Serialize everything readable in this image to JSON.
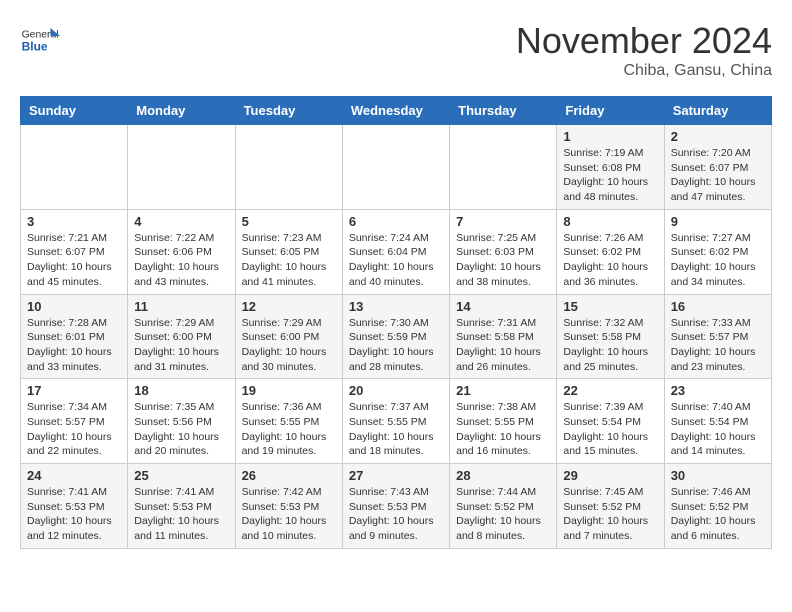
{
  "header": {
    "logo_general": "General",
    "logo_blue": "Blue",
    "month_title": "November 2024",
    "location": "Chiba, Gansu, China"
  },
  "weekdays": [
    "Sunday",
    "Monday",
    "Tuesday",
    "Wednesday",
    "Thursday",
    "Friday",
    "Saturday"
  ],
  "weeks": [
    [
      {
        "day": "",
        "info": ""
      },
      {
        "day": "",
        "info": ""
      },
      {
        "day": "",
        "info": ""
      },
      {
        "day": "",
        "info": ""
      },
      {
        "day": "",
        "info": ""
      },
      {
        "day": "1",
        "info": "Sunrise: 7:19 AM\nSunset: 6:08 PM\nDaylight: 10 hours and 48 minutes."
      },
      {
        "day": "2",
        "info": "Sunrise: 7:20 AM\nSunset: 6:07 PM\nDaylight: 10 hours and 47 minutes."
      }
    ],
    [
      {
        "day": "3",
        "info": "Sunrise: 7:21 AM\nSunset: 6:07 PM\nDaylight: 10 hours and 45 minutes."
      },
      {
        "day": "4",
        "info": "Sunrise: 7:22 AM\nSunset: 6:06 PM\nDaylight: 10 hours and 43 minutes."
      },
      {
        "day": "5",
        "info": "Sunrise: 7:23 AM\nSunset: 6:05 PM\nDaylight: 10 hours and 41 minutes."
      },
      {
        "day": "6",
        "info": "Sunrise: 7:24 AM\nSunset: 6:04 PM\nDaylight: 10 hours and 40 minutes."
      },
      {
        "day": "7",
        "info": "Sunrise: 7:25 AM\nSunset: 6:03 PM\nDaylight: 10 hours and 38 minutes."
      },
      {
        "day": "8",
        "info": "Sunrise: 7:26 AM\nSunset: 6:02 PM\nDaylight: 10 hours and 36 minutes."
      },
      {
        "day": "9",
        "info": "Sunrise: 7:27 AM\nSunset: 6:02 PM\nDaylight: 10 hours and 34 minutes."
      }
    ],
    [
      {
        "day": "10",
        "info": "Sunrise: 7:28 AM\nSunset: 6:01 PM\nDaylight: 10 hours and 33 minutes."
      },
      {
        "day": "11",
        "info": "Sunrise: 7:29 AM\nSunset: 6:00 PM\nDaylight: 10 hours and 31 minutes."
      },
      {
        "day": "12",
        "info": "Sunrise: 7:29 AM\nSunset: 6:00 PM\nDaylight: 10 hours and 30 minutes."
      },
      {
        "day": "13",
        "info": "Sunrise: 7:30 AM\nSunset: 5:59 PM\nDaylight: 10 hours and 28 minutes."
      },
      {
        "day": "14",
        "info": "Sunrise: 7:31 AM\nSunset: 5:58 PM\nDaylight: 10 hours and 26 minutes."
      },
      {
        "day": "15",
        "info": "Sunrise: 7:32 AM\nSunset: 5:58 PM\nDaylight: 10 hours and 25 minutes."
      },
      {
        "day": "16",
        "info": "Sunrise: 7:33 AM\nSunset: 5:57 PM\nDaylight: 10 hours and 23 minutes."
      }
    ],
    [
      {
        "day": "17",
        "info": "Sunrise: 7:34 AM\nSunset: 5:57 PM\nDaylight: 10 hours and 22 minutes."
      },
      {
        "day": "18",
        "info": "Sunrise: 7:35 AM\nSunset: 5:56 PM\nDaylight: 10 hours and 20 minutes."
      },
      {
        "day": "19",
        "info": "Sunrise: 7:36 AM\nSunset: 5:55 PM\nDaylight: 10 hours and 19 minutes."
      },
      {
        "day": "20",
        "info": "Sunrise: 7:37 AM\nSunset: 5:55 PM\nDaylight: 10 hours and 18 minutes."
      },
      {
        "day": "21",
        "info": "Sunrise: 7:38 AM\nSunset: 5:55 PM\nDaylight: 10 hours and 16 minutes."
      },
      {
        "day": "22",
        "info": "Sunrise: 7:39 AM\nSunset: 5:54 PM\nDaylight: 10 hours and 15 minutes."
      },
      {
        "day": "23",
        "info": "Sunrise: 7:40 AM\nSunset: 5:54 PM\nDaylight: 10 hours and 14 minutes."
      }
    ],
    [
      {
        "day": "24",
        "info": "Sunrise: 7:41 AM\nSunset: 5:53 PM\nDaylight: 10 hours and 12 minutes."
      },
      {
        "day": "25",
        "info": "Sunrise: 7:41 AM\nSunset: 5:53 PM\nDaylight: 10 hours and 11 minutes."
      },
      {
        "day": "26",
        "info": "Sunrise: 7:42 AM\nSunset: 5:53 PM\nDaylight: 10 hours and 10 minutes."
      },
      {
        "day": "27",
        "info": "Sunrise: 7:43 AM\nSunset: 5:53 PM\nDaylight: 10 hours and 9 minutes."
      },
      {
        "day": "28",
        "info": "Sunrise: 7:44 AM\nSunset: 5:52 PM\nDaylight: 10 hours and 8 minutes."
      },
      {
        "day": "29",
        "info": "Sunrise: 7:45 AM\nSunset: 5:52 PM\nDaylight: 10 hours and 7 minutes."
      },
      {
        "day": "30",
        "info": "Sunrise: 7:46 AM\nSunset: 5:52 PM\nDaylight: 10 hours and 6 minutes."
      }
    ]
  ]
}
